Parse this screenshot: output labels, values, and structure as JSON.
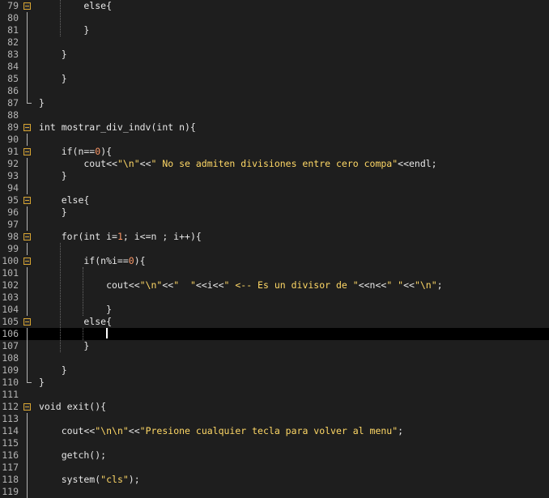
{
  "editor": {
    "colors": {
      "background": "#1e1e1e",
      "current_line": "#000000",
      "string": "#ffd866",
      "number": "#fc9867",
      "text": "#e6e6e6",
      "line_number": "#b4b4b4",
      "fold_marker": "#d7a431"
    },
    "lines": [
      {
        "n": "79",
        "fold": "box",
        "code": [
          {
            "t": "        else{",
            "k": "plain"
          }
        ]
      },
      {
        "n": "80",
        "fold": "line",
        "code": []
      },
      {
        "n": "81",
        "fold": "line",
        "code": [
          {
            "t": "        }",
            "k": "plain"
          }
        ]
      },
      {
        "n": "82",
        "fold": "line",
        "code": []
      },
      {
        "n": "83",
        "fold": "line",
        "code": [
          {
            "t": "    }",
            "k": "plain"
          }
        ]
      },
      {
        "n": "84",
        "fold": "line",
        "code": []
      },
      {
        "n": "85",
        "fold": "line",
        "code": [
          {
            "t": "    }",
            "k": "plain"
          }
        ]
      },
      {
        "n": "86",
        "fold": "line",
        "code": []
      },
      {
        "n": "87",
        "fold": "end",
        "code": [
          {
            "t": "}",
            "k": "plain"
          }
        ]
      },
      {
        "n": "88",
        "fold": "none",
        "code": []
      },
      {
        "n": "89",
        "fold": "box",
        "code": [
          {
            "t": "int mostrar_div_indv(int n){",
            "k": "plain"
          }
        ]
      },
      {
        "n": "90",
        "fold": "line",
        "code": []
      },
      {
        "n": "91",
        "fold": "box",
        "code": [
          {
            "t": "    if(n==",
            "k": "plain"
          },
          {
            "t": "0",
            "k": "num"
          },
          {
            "t": "){",
            "k": "plain"
          }
        ]
      },
      {
        "n": "92",
        "fold": "line",
        "code": [
          {
            "t": "        cout<<",
            "k": "plain"
          },
          {
            "t": "\"\\n\"",
            "k": "str"
          },
          {
            "t": "<<",
            "k": "plain"
          },
          {
            "t": "\" No se admiten divisiones entre cero compa\"",
            "k": "str"
          },
          {
            "t": "<<endl;",
            "k": "plain"
          }
        ]
      },
      {
        "n": "93",
        "fold": "line",
        "code": [
          {
            "t": "    }",
            "k": "plain"
          }
        ]
      },
      {
        "n": "94",
        "fold": "line",
        "code": []
      },
      {
        "n": "95",
        "fold": "box",
        "code": [
          {
            "t": "    else{",
            "k": "plain"
          }
        ]
      },
      {
        "n": "96",
        "fold": "line",
        "code": [
          {
            "t": "    }",
            "k": "plain"
          }
        ]
      },
      {
        "n": "97",
        "fold": "line",
        "code": []
      },
      {
        "n": "98",
        "fold": "box",
        "code": [
          {
            "t": "    for(int i=",
            "k": "plain"
          },
          {
            "t": "1",
            "k": "num"
          },
          {
            "t": "; i<=n ; i++){",
            "k": "plain"
          }
        ]
      },
      {
        "n": "99",
        "fold": "line",
        "code": []
      },
      {
        "n": "100",
        "fold": "box",
        "code": [
          {
            "t": "        if(n%i==",
            "k": "plain"
          },
          {
            "t": "0",
            "k": "num"
          },
          {
            "t": "){",
            "k": "plain"
          }
        ]
      },
      {
        "n": "101",
        "fold": "line",
        "code": []
      },
      {
        "n": "102",
        "fold": "line",
        "code": [
          {
            "t": "            cout<<",
            "k": "plain"
          },
          {
            "t": "\"\\n\"",
            "k": "str"
          },
          {
            "t": "<<",
            "k": "plain"
          },
          {
            "t": "\"  \"",
            "k": "str"
          },
          {
            "t": "<<i<<",
            "k": "plain"
          },
          {
            "t": "\" <-- Es un divisor de \"",
            "k": "str"
          },
          {
            "t": "<<n<<",
            "k": "plain"
          },
          {
            "t": "\" \"",
            "k": "str"
          },
          {
            "t": "<<",
            "k": "plain"
          },
          {
            "t": "\"\\n\"",
            "k": "str"
          },
          {
            "t": ";",
            "k": "plain"
          }
        ]
      },
      {
        "n": "103",
        "fold": "line",
        "code": []
      },
      {
        "n": "104",
        "fold": "line",
        "code": [
          {
            "t": "            }",
            "k": "plain"
          }
        ]
      },
      {
        "n": "105",
        "fold": "box",
        "code": [
          {
            "t": "        else{",
            "k": "plain"
          }
        ]
      },
      {
        "n": "106",
        "fold": "line",
        "current": true,
        "code": []
      },
      {
        "n": "107",
        "fold": "line",
        "code": [
          {
            "t": "        }",
            "k": "plain"
          }
        ]
      },
      {
        "n": "108",
        "fold": "line",
        "code": []
      },
      {
        "n": "109",
        "fold": "line",
        "code": [
          {
            "t": "    }",
            "k": "plain"
          }
        ]
      },
      {
        "n": "110",
        "fold": "end",
        "code": [
          {
            "t": "}",
            "k": "plain"
          }
        ]
      },
      {
        "n": "111",
        "fold": "none",
        "code": []
      },
      {
        "n": "112",
        "fold": "box",
        "code": [
          {
            "t": "void exit(){",
            "k": "plain"
          }
        ]
      },
      {
        "n": "113",
        "fold": "line",
        "code": []
      },
      {
        "n": "114",
        "fold": "line",
        "code": [
          {
            "t": "    cout<<",
            "k": "plain"
          },
          {
            "t": "\"\\n\\n\"",
            "k": "str"
          },
          {
            "t": "<<",
            "k": "plain"
          },
          {
            "t": "\"Presione cualquier tecla para volver al menu\"",
            "k": "str"
          },
          {
            "t": ";",
            "k": "plain"
          }
        ]
      },
      {
        "n": "115",
        "fold": "line",
        "code": []
      },
      {
        "n": "116",
        "fold": "line",
        "code": [
          {
            "t": "    getch();",
            "k": "plain"
          }
        ]
      },
      {
        "n": "117",
        "fold": "line",
        "code": []
      },
      {
        "n": "118",
        "fold": "line",
        "code": [
          {
            "t": "    system(",
            "k": "plain"
          },
          {
            "t": "\"cls\"",
            "k": "str"
          },
          {
            "t": ");",
            "k": "plain"
          }
        ]
      },
      {
        "n": "119",
        "fold": "line",
        "code": []
      }
    ]
  }
}
